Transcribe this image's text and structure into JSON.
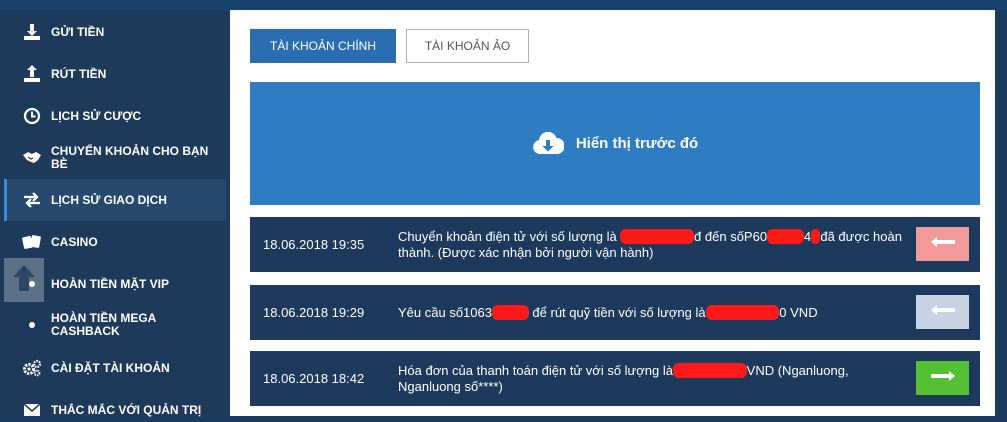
{
  "sidebar": {
    "items": [
      {
        "label": "GỬI TIỀN",
        "icon": "download-icon"
      },
      {
        "label": "RÚT TIỀN",
        "icon": "upload-icon"
      },
      {
        "label": "LỊCH SỬ CƯỢC",
        "icon": "clock-icon"
      },
      {
        "label": "CHUYỂN KHOẢN CHO BẠN BÈ",
        "icon": "transfer-friends-icon"
      },
      {
        "label": "LỊCH SỬ GIAO DỊCH",
        "icon": "swap-arrows-icon"
      },
      {
        "label": "CASINO",
        "icon": "playing-cards-icon"
      },
      {
        "label": "HOÀN TIỀN MẶT VIP",
        "icon": "bullet-icon"
      },
      {
        "label": "HOÀN TIỀN MEGA CASHBACK",
        "icon": "bullet-icon"
      },
      {
        "label": "CÀI ĐẶT TÀI KHOẢN",
        "icon": "gears-icon"
      },
      {
        "label": "THẮC MẮC VỚI QUẢN TRỊ",
        "icon": "envelope-icon"
      }
    ]
  },
  "tabs": {
    "primary": "TÀI KHOẢN CHÍNH",
    "secondary": "TÀI KHOẢN ẢO"
  },
  "show_previous": "Hiển thị trước đó",
  "transactions": [
    {
      "date": "18.06.2018 19:35",
      "parts": [
        "Chuyển khoản điện tử với số lượng là ",
        "████████",
        "đ đến sốP60",
        "████",
        "4",
        "█",
        "đã được hoàn thành. (Được xác nhận bởi người vận hành)"
      ],
      "action": "arrow-left-icon"
    },
    {
      "date": "18.06.2018 19:29",
      "parts": [
        "Yêu cầu số1063",
        "████",
        " để rút quỹ tiền với số lượng là",
        "████████",
        "0 VND"
      ],
      "action": "arrow-left-icon"
    },
    {
      "date": "18.06.2018 18:42",
      "parts": [
        "Hóa đơn của thanh toán điện tử với số lượng là",
        "████████",
        "VND (Nganluong, Nganluong số****)"
      ],
      "action": "arrow-right-icon"
    }
  ],
  "colors": {
    "sidebar_bg": "#1e3a5a",
    "tab_active": "#2a6db0",
    "show_previous_bg": "#2e7cc2",
    "row_bg": "#1d3a5c",
    "action_red": "#f29a9a",
    "action_grey": "#c7d3e2",
    "action_green": "#55c032"
  }
}
